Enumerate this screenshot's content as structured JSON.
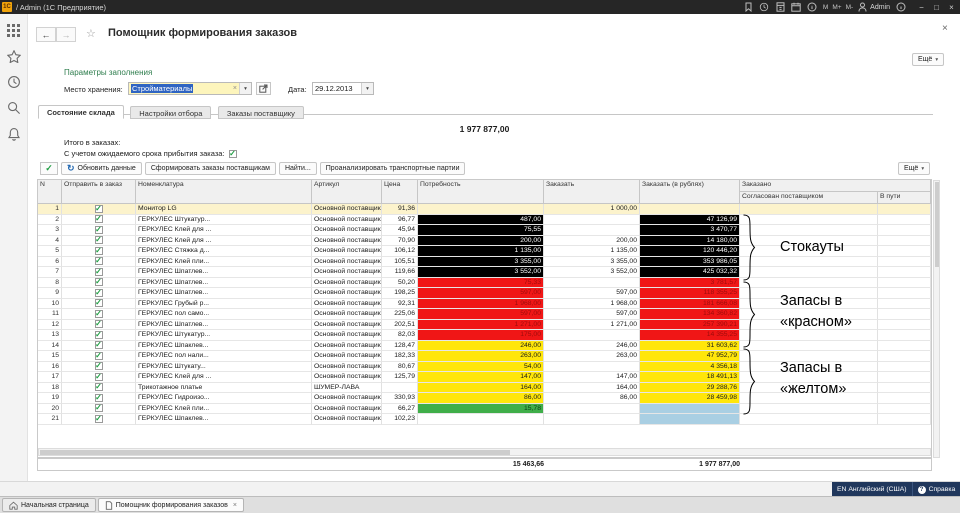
{
  "ui": {
    "caret_down": "▾",
    "clear_x": "×",
    "check_mark": "✓",
    "refresh_glyph": "↻"
  },
  "titlebar": {
    "logo": "1С",
    "title": "/ Admin (1С Предприятие)",
    "memory_buttons": [
      "M",
      "M+",
      "M-"
    ],
    "user": "Admin",
    "minimize": "−",
    "maximize": "□",
    "close": "×"
  },
  "form": {
    "title": "Помощник формирования заказов",
    "close": "×",
    "back": "←",
    "forward": "→",
    "favorite_star": "☆",
    "more_button": "Ещё",
    "params": {
      "section_title": "Параметры заполнения",
      "storage_label": "Место хранения:",
      "storage_value": "Стройматериалы",
      "date_label": "Дата:",
      "date_value": "29.12.2013"
    },
    "tabs": [
      {
        "label": "Состояние склада",
        "active": true
      },
      {
        "label": "Настройки отбора",
        "active": false
      },
      {
        "label": "Заказы поставщику",
        "active": false
      }
    ],
    "summary": {
      "grand_total": "1 977 877,00",
      "total_label": "Итого в заказах:",
      "lead_time_label": "С учетом ожидаемого срока прибытия заказа:",
      "lead_time_checked": true
    },
    "toolbar": {
      "refresh_label": "Обновить данные",
      "create_orders_label": "Сформировать заказы поставщикам",
      "find_label": "Найти...",
      "analyze_label": "Проанализировать транспортные партии",
      "more_label": "Ещё"
    }
  },
  "table": {
    "columns": {
      "n": "N",
      "send": "Отправить в заказ",
      "name": "Номенклатура",
      "article": "Артикул",
      "price": "Цена",
      "need": "Потребность",
      "order": "Заказать",
      "order_rub": "Заказать (в рублях)",
      "ordered": "Заказано",
      "approved": "Согласован поставщиком",
      "in_transit": "В пути"
    },
    "cell_colors": {
      "stockout": {
        "bg": "#000000",
        "fg": "#ffffff"
      },
      "critical": {
        "bg": "#f01616",
        "fg": "#9e0c0c"
      },
      "warning": {
        "bg": "#ffe60a",
        "fg": "#1a1a1a"
      },
      "ok": {
        "bg": "#3fae49",
        "fg": "#0d3a13"
      },
      "info": {
        "bg": "#a9cfe3",
        "fg": "#1a1a1a"
      }
    },
    "rows": [
      {
        "n": "1",
        "checked": true,
        "selected": true,
        "name": "Монитор LG",
        "supplier": "Основной поставщик",
        "price": "91,36",
        "need": "",
        "need_color": null,
        "order": "1 000,00",
        "rub": "",
        "rub_color": null
      },
      {
        "n": "2",
        "checked": true,
        "name": "ГЕРКУЛЕС Штукатур...",
        "supplier": "Основной поставщик",
        "price": "96,77",
        "need": "487,00",
        "need_color": "stockout",
        "order": "",
        "rub": "47 126,99",
        "rub_color": "stockout"
      },
      {
        "n": "3",
        "checked": true,
        "name": "ГЕРКУЛЕС Клей для ...",
        "supplier": "Основной поставщик",
        "price": "45,94",
        "need": "75,55",
        "need_color": "stockout",
        "order": "",
        "rub": "3 470,77",
        "rub_color": "stockout"
      },
      {
        "n": "4",
        "checked": true,
        "name": "ГЕРКУЛЕС Клей для ...",
        "supplier": "Основной поставщик",
        "price": "70,90",
        "need": "200,00",
        "need_color": "stockout",
        "order": "200,00",
        "rub": "14 180,00",
        "rub_color": "stockout"
      },
      {
        "n": "5",
        "checked": true,
        "name": "ГЕРКУЛЕС Стяжка д...",
        "supplier": "Основной поставщик",
        "price": "106,12",
        "need": "1 135,00",
        "need_color": "stockout",
        "order": "1 135,00",
        "rub": "120 446,20",
        "rub_color": "stockout"
      },
      {
        "n": "6",
        "checked": true,
        "name": "ГЕРКУЛЕС Клей пли...",
        "supplier": "Основной поставщик",
        "price": "105,51",
        "need": "3 355,00",
        "need_color": "stockout",
        "order": "3 355,00",
        "rub": "353 986,05",
        "rub_color": "stockout"
      },
      {
        "n": "7",
        "checked": true,
        "name": "ГЕРКУЛЕС Шпатлев...",
        "supplier": "Основной поставщик",
        "price": "119,66",
        "need": "3 552,00",
        "need_color": "stockout",
        "order": "3 552,00",
        "rub": "425 032,32",
        "rub_color": "stockout"
      },
      {
        "n": "8",
        "checked": true,
        "name": "ГЕРКУЛЕС Шпатлев...",
        "supplier": "Основной поставщик",
        "price": "50,20",
        "need": "75,33",
        "need_color": "critical",
        "order": "",
        "rub": "3 781,57",
        "rub_color": "critical"
      },
      {
        "n": "9",
        "checked": true,
        "name": "ГЕРКУЛЕС Шпатлев...",
        "supplier": "Основной поставщик",
        "price": "198,25",
        "need": "597,00",
        "need_color": "critical",
        "order": "597,00",
        "rub": "118 355,25",
        "rub_color": "critical"
      },
      {
        "n": "10",
        "checked": true,
        "name": "ГЕРКУЛЕС Грубый р...",
        "supplier": "Основной поставщик",
        "price": "92,31",
        "need": "1 968,00",
        "need_color": "critical",
        "order": "1 968,00",
        "rub": "181 666,08",
        "rub_color": "critical"
      },
      {
        "n": "11",
        "checked": true,
        "name": "ГЕРКУЛЕС пол само...",
        "supplier": "Основной поставщик",
        "price": "225,06",
        "need": "597,00",
        "need_color": "critical",
        "order": "597,00",
        "rub": "134 360,82",
        "rub_color": "critical"
      },
      {
        "n": "12",
        "checked": true,
        "name": "ГЕРКУЛЕС Шпатлев...",
        "supplier": "Основной поставщик",
        "price": "202,51",
        "need": "1 271,00",
        "need_color": "critical",
        "order": "1 271,00",
        "rub": "257 390,21",
        "rub_color": "critical"
      },
      {
        "n": "13",
        "checked": true,
        "name": "ГЕРКУЛЕС Штукатур...",
        "supplier": "Основной поставщик",
        "price": "82,03",
        "need": "175,00",
        "need_color": "critical",
        "order": "",
        "rub": "14 355,25",
        "rub_color": "critical"
      },
      {
        "n": "14",
        "checked": true,
        "name": "ГЕРКУЛЕС Шпаклев...",
        "supplier": "Основной поставщик",
        "price": "128,47",
        "need": "246,00",
        "need_color": "warning",
        "order": "246,00",
        "rub": "31 603,62",
        "rub_color": "warning"
      },
      {
        "n": "15",
        "checked": true,
        "name": "ГЕРКУЛЕС пол нали...",
        "supplier": "Основной поставщик",
        "price": "182,33",
        "need": "263,00",
        "need_color": "warning",
        "order": "263,00",
        "rub": "47 952,79",
        "rub_color": "warning"
      },
      {
        "n": "16",
        "checked": true,
        "name": "ГЕРКУЛЕС Штукату...",
        "supplier": "Основной поставщик",
        "price": "80,67",
        "need": "54,00",
        "need_color": "warning",
        "order": "",
        "rub": "4 356,18",
        "rub_color": "warning"
      },
      {
        "n": "17",
        "checked": true,
        "name": "ГЕРКУЛЕС Клей для ...",
        "supplier": "Основной поставщик",
        "price": "125,79",
        "need": "147,00",
        "need_color": "warning",
        "order": "147,00",
        "rub": "18 491,13",
        "rub_color": "warning"
      },
      {
        "n": "18",
        "checked": true,
        "name": "Трикотажное платье",
        "supplier": "ШУМЕР-ЛАВА",
        "price": "",
        "need": "164,00",
        "need_color": "warning",
        "order": "164,00",
        "rub": "29 288,76",
        "rub_color": "warning"
      },
      {
        "n": "19",
        "checked": true,
        "name": "ГЕРКУЛЕС Гидроизо...",
        "supplier": "Основной поставщик",
        "price": "330,93",
        "need": "86,00",
        "need_color": "warning",
        "order": "86,00",
        "rub": "28 459,98",
        "rub_color": "warning"
      },
      {
        "n": "20",
        "checked": true,
        "name": "ГЕРКУЛЕС Клей пли...",
        "supplier": "Основной поставщик",
        "price": "66,27",
        "need": "15,78",
        "need_color": "ok",
        "order": "",
        "rub": "",
        "rub_color": "info"
      },
      {
        "n": "21",
        "checked": true,
        "name": "ГЕРКУЛЕС Шпаклев...",
        "supplier": "Основной поставщик",
        "price": "102,23",
        "need": "",
        "need_color": null,
        "order": "",
        "rub": "",
        "rub_color": "info"
      }
    ],
    "footer": {
      "need_total": "15 463,66",
      "order_rub_total": "1 977 877,00"
    }
  },
  "annotations": {
    "items": [
      {
        "lines": [
          "Стокауты"
        ]
      },
      {
        "lines": [
          "Запасы в",
          "«красном»"
        ]
      },
      {
        "lines": [
          "Запасы в",
          "«желтом»"
        ]
      }
    ]
  },
  "statusbar": {
    "language": "EN Английский (США)",
    "help_label": "Справка",
    "help_symbol": "?"
  },
  "bottom_tabs": [
    {
      "label": "Начальная страница",
      "active": false
    },
    {
      "label": "Помощник формирования заказов",
      "close": "×",
      "active": true
    }
  ]
}
